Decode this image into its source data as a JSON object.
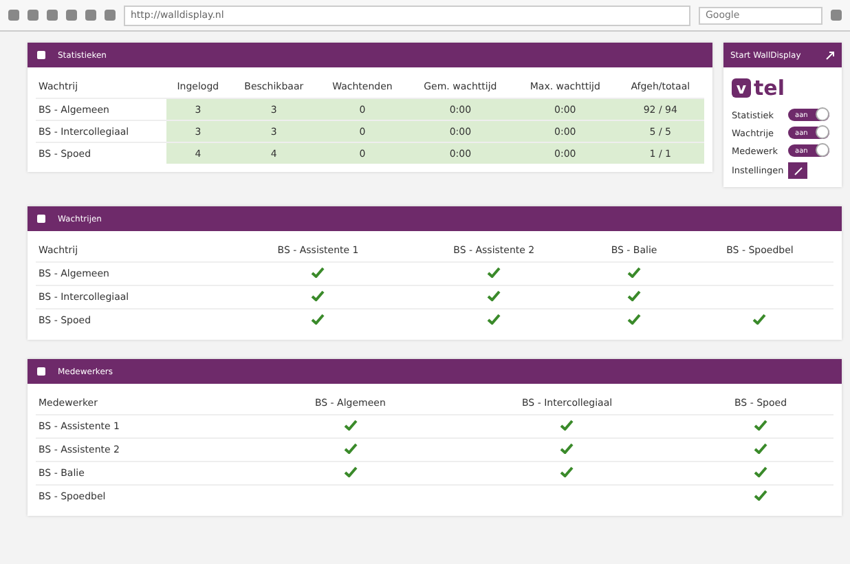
{
  "browser": {
    "address": "http://walldisplay.nl",
    "search_placeholder": "Google"
  },
  "statistics": {
    "title": "Statistieken",
    "columns": [
      "Wachtrij",
      "Ingelogd",
      "Beschikbaar",
      "Wachtenden",
      "Gem. wachttijd",
      "Max. wachttijd",
      "Afgeh/totaal"
    ],
    "rows": [
      [
        "BS - Algemeen",
        "3",
        "3",
        "0",
        "0:00",
        "0:00",
        "92 / 94"
      ],
      [
        "BS - Intercollegiaal",
        "3",
        "3",
        "0",
        "0:00",
        "0:00",
        "5 / 5"
      ],
      [
        "BS - Spoed",
        "4",
        "4",
        "0",
        "0:00",
        "0:00",
        "1 / 1"
      ]
    ]
  },
  "side": {
    "start_button": "Start WallDisplay",
    "logo": {
      "mark": "v",
      "text": "tel"
    },
    "toggles": [
      {
        "label": "Statistiek",
        "text": "aan",
        "on": true
      },
      {
        "label": "Wachtrije",
        "text": "aan",
        "on": true
      },
      {
        "label": "Medewerk",
        "text": "aan",
        "on": true
      }
    ],
    "settings_label": "Instellingen"
  },
  "queues": {
    "title": "Wachtrijen",
    "columns": [
      "Wachtrij",
      "BS - Assistente 1",
      "BS - Assistente 2",
      "BS - Balie",
      "BS - Spoedbel"
    ],
    "rows": [
      {
        "name": "BS - Algemeen",
        "checked": [
          true,
          true,
          true,
          false
        ]
      },
      {
        "name": "BS - Intercollegiaal",
        "checked": [
          true,
          true,
          true,
          false
        ]
      },
      {
        "name": "BS - Spoed",
        "checked": [
          true,
          true,
          true,
          true
        ]
      }
    ]
  },
  "employees": {
    "title": "Medewerkers",
    "columns": [
      "Medewerker",
      "BS - Algemeen",
      "BS - Intercollegiaal",
      "BS - Spoed"
    ],
    "rows": [
      {
        "name": "BS - Assistente 1",
        "checked": [
          true,
          true,
          true
        ]
      },
      {
        "name": "BS - Assistente 2",
        "checked": [
          true,
          true,
          true
        ]
      },
      {
        "name": "BS - Balie",
        "checked": [
          true,
          true,
          true
        ]
      },
      {
        "name": "BS - Spoedbel",
        "checked": [
          false,
          false,
          true
        ]
      }
    ]
  }
}
